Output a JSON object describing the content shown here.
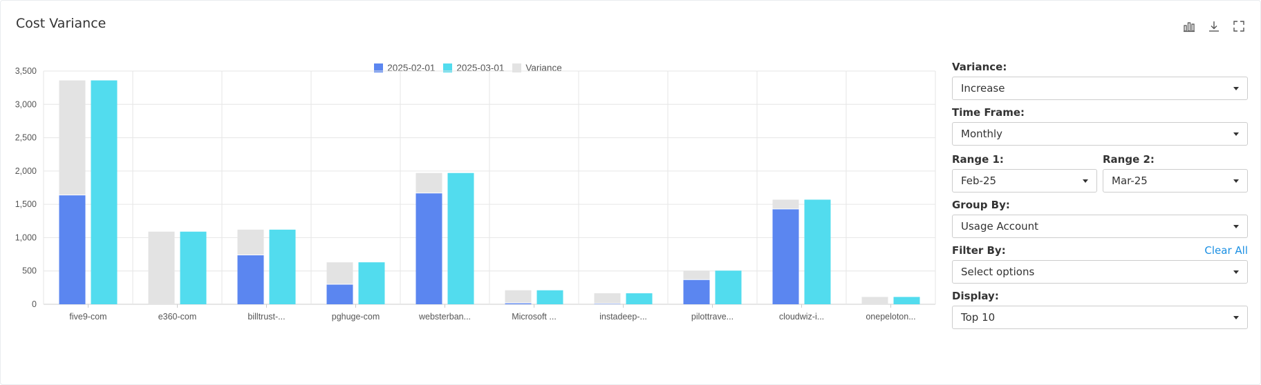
{
  "header": {
    "title": "Cost Variance"
  },
  "toolbar": {
    "icons": [
      "bar-chart-icon",
      "download-icon",
      "fullscreen-icon"
    ]
  },
  "colors": {
    "series1": "#5b86f0",
    "series2": "#52dcee",
    "variance": "#e3e3e3",
    "link": "#1a8fe3"
  },
  "chart_data": {
    "type": "bar",
    "categories": [
      "five9-com",
      "e360-com",
      "billtrust-...",
      "pghuge-com",
      "websterban...",
      "Microsoft ...",
      "instadeep-...",
      "pilottrave...",
      "cloudwiz-i...",
      "onepeloton..."
    ],
    "series": [
      {
        "name": "2025-02-01",
        "values": [
          1640,
          0,
          740,
          300,
          1670,
          20,
          10,
          370,
          1430,
          0
        ]
      },
      {
        "name": "2025-03-01",
        "values": [
          3360,
          1090,
          1120,
          630,
          1970,
          210,
          165,
          505,
          1570,
          110
        ]
      },
      {
        "name": "Variance",
        "values": [
          1720,
          1090,
          380,
          330,
          300,
          190,
          155,
          135,
          140,
          110
        ]
      }
    ],
    "y_ticks": [
      "0",
      "500",
      "1,000",
      "1,500",
      "2,000",
      "2,500",
      "3,000",
      "3,500"
    ],
    "ylim": [
      0,
      3500
    ],
    "legend_position": "top-center",
    "grid": true
  },
  "filters": {
    "variance": {
      "label": "Variance:",
      "value": "Increase"
    },
    "time_frame": {
      "label": "Time Frame:",
      "value": "Monthly"
    },
    "range1": {
      "label": "Range 1:",
      "value": "Feb-25"
    },
    "range2": {
      "label": "Range 2:",
      "value": "Mar-25"
    },
    "group_by": {
      "label": "Group By:",
      "value": "Usage Account"
    },
    "filter_by": {
      "label": "Filter By:",
      "placeholder": "Select options",
      "clear_label": "Clear All"
    },
    "display": {
      "label": "Display:",
      "value": "Top 10"
    }
  }
}
